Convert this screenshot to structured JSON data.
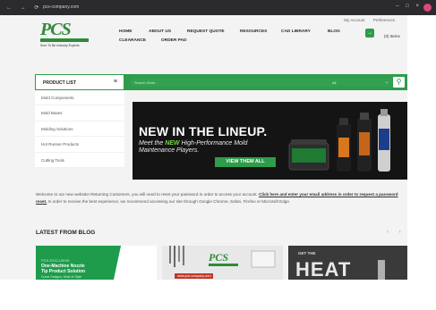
{
  "browser": {
    "nav_glyphs": "← → ⟳",
    "url": "pcs-company.com",
    "window_controls": "– □ ×"
  },
  "account": {
    "my_account": "My Account",
    "preferences": "Preferences"
  },
  "logo": {
    "mark": "PCS",
    "tagline": "Sure To Be Industry Experts"
  },
  "menu": {
    "home": "HOME",
    "about": "ABOUT US",
    "quote": "REQUEST QUOTE",
    "resources": "RESOURCES",
    "cad": "CAD LIBRARY",
    "blog": "BLOG",
    "clearance": "CLEARANCE",
    "order_pad": "ORDER PAD"
  },
  "cart": {
    "label": "(0) Items"
  },
  "product_list": {
    "label": "PRODUCT LIST"
  },
  "search": {
    "placeholder": "Search Store",
    "category": "All",
    "select_arrow": "⌄"
  },
  "sidebar": {
    "items": [
      "Mold Components",
      "Mold Bases",
      "Molding Solutions",
      "Hot Runner Products",
      "Cutting Tools"
    ]
  },
  "banner": {
    "headline": "NEW IN THE LINEUP.",
    "sub_meet": "Meet the ",
    "sub_new": "NEW",
    "sub_rest": " High-Performance Mold",
    "sub_line2": "Maintenance Players.",
    "cta": "VIEW THEM ALL"
  },
  "welcome": {
    "text1": "Welcome to our new website! Returning Customers, you will need to reset your password in order to access your account. ",
    "link": "Click here and enter your email address in order to request a password reset.",
    "text2": " In order to receive the best experience, we recommend accessing our site through Google Chrome, Safari, Firefox or Microsoft Edge."
  },
  "blog": {
    "title": "LATEST FROM BLOG",
    "nav": "‹ ›",
    "card1": {
      "kicker": "PCS EXCLUSIVE",
      "title1": "One-Machine Nozzle",
      "title2": "Tip Product Solution",
      "meta": "Curve Designs, Mold of Style"
    },
    "card2": {
      "mark": "PCS",
      "url": "www.pcs-company.com"
    },
    "card3": {
      "small": "GET THE",
      "big": "HEAT"
    }
  },
  "colors": {
    "brand_green": "#2e9c4a",
    "dark_banner": "#141414"
  }
}
